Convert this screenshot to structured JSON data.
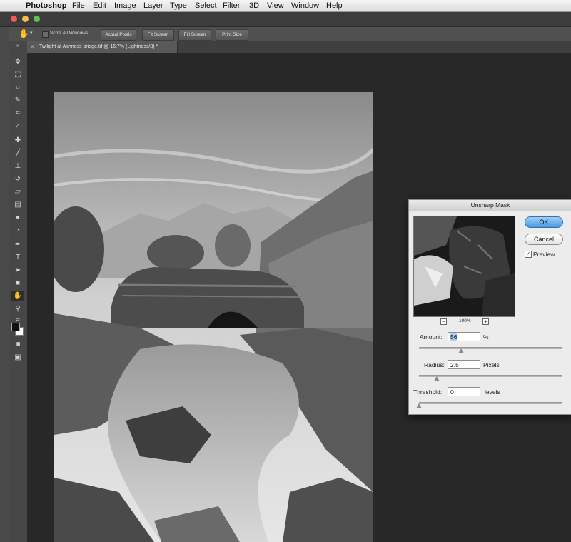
{
  "menubar": {
    "app": "Photoshop",
    "items": [
      "File",
      "Edit",
      "Image",
      "Layer",
      "Type",
      "Select",
      "Filter",
      "3D",
      "View",
      "Window",
      "Help"
    ]
  },
  "options": {
    "scroll_all_windows": "Scroll All Windows",
    "buttons": [
      "Actual Pixels",
      "Fit Screen",
      "Fill Screen",
      "Print Size"
    ]
  },
  "document": {
    "tab_title": "Twilight at Ashness bridge.tif @ 16.7% (Lightness/8) *"
  },
  "tools": [
    "move-tool",
    "marquee-tool",
    "lasso-tool",
    "quick-selection-tool",
    "crop-tool",
    "eyedropper-tool",
    "healing-brush-tool",
    "brush-tool",
    "clone-stamp-tool",
    "history-brush-tool",
    "eraser-tool",
    "gradient-tool",
    "blur-tool",
    "dodge-tool",
    "pen-tool",
    "type-tool",
    "path-selection-tool",
    "rectangle-tool",
    "hand-tool",
    "zoom-tool"
  ],
  "dialog": {
    "title": "Unsharp Mask",
    "ok_label": "OK",
    "cancel_label": "Cancel",
    "preview_label": "Preview",
    "preview_checked": true,
    "zoom_label": "100%",
    "amount_label": "Amount:",
    "amount_value": "56",
    "amount_unit": "%",
    "radius_label": "Radius:",
    "radius_value": "2.5",
    "radius_unit": "Pixels",
    "threshold_label": "Threshold:",
    "threshold_value": "0",
    "threshold_unit": "levels"
  },
  "colors": {
    "accent": "#4a98e4",
    "canvas": "#282828"
  }
}
